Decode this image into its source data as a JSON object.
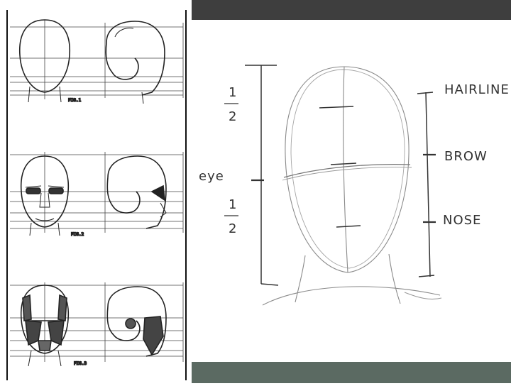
{
  "colors": {
    "top_bar": "#3e3e3e",
    "bottom_bar": "#5b6a62",
    "ink": "#222222",
    "pencil": "#888888"
  },
  "left_panel": {
    "figure_labels": [
      "FIG.1",
      "FIG.2",
      "FIG.3"
    ]
  },
  "right_panel": {
    "labels": {
      "hairline": "HAIRLINE",
      "brow": "BROW",
      "nose": "NOSE",
      "eye": "eye",
      "half_top_num": "1",
      "half_top_den": "2",
      "half_bottom_num": "1",
      "half_bottom_den": "2"
    }
  }
}
